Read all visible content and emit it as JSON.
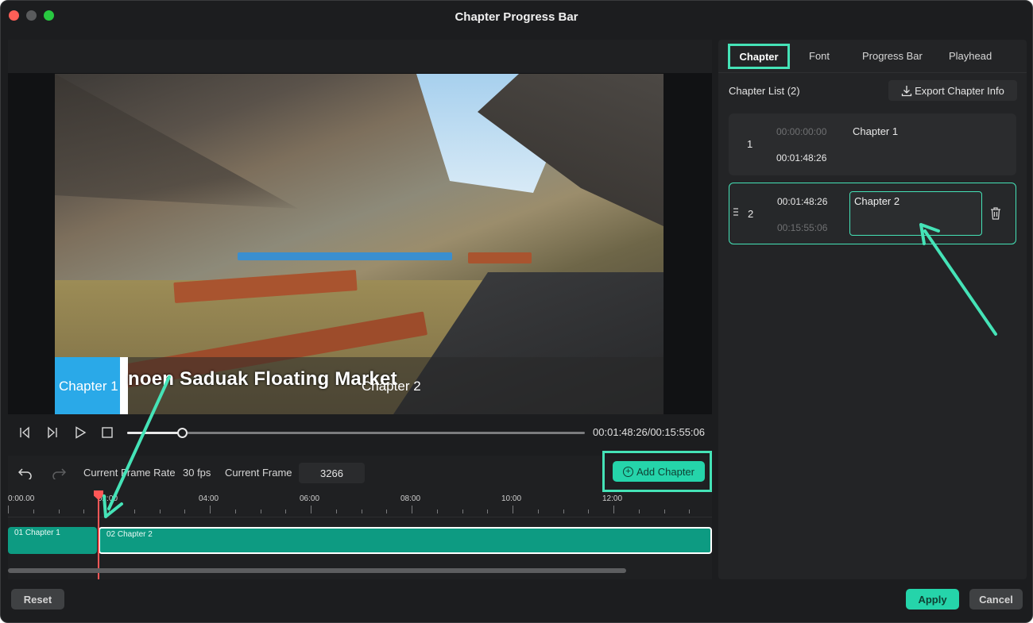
{
  "window": {
    "title": "Chapter Progress Bar"
  },
  "preview": {
    "overlay_text": "noen Saduak Floating Market",
    "caption_chapter1": "Chapter 1",
    "caption_chapter2": "Chapter 2",
    "timecode": "00:01:48:26/00:15:55:06",
    "progress_fraction": 0.12
  },
  "timeline": {
    "frame_rate_label": "Current Frame Rate",
    "frame_rate_value": "30 fps",
    "current_frame_label": "Current Frame",
    "current_frame_value": "3266",
    "add_chapter_label": "Add Chapter",
    "ruler_labels": [
      "0:00.00",
      "02:00",
      "04:00",
      "06:00",
      "08:00",
      "10:00",
      "12:00"
    ],
    "clips": [
      {
        "label": "01 Chapter 1"
      },
      {
        "label": "02 Chapter 2"
      }
    ]
  },
  "panel": {
    "tabs": [
      "Chapter",
      "Font",
      "Progress Bar",
      "Playhead"
    ],
    "active_tab": "Chapter",
    "chapter_list_title": "Chapter List (2)",
    "export_label": "Export Chapter Info",
    "chapters": [
      {
        "index": "1",
        "start": "00:00:00:00",
        "end": "00:01:48:26",
        "name": "Chapter 1"
      },
      {
        "index": "2",
        "start": "00:01:48:26",
        "end": "00:15:55:06",
        "name": "Chapter 2"
      }
    ]
  },
  "footer": {
    "reset_label": "Reset",
    "apply_label": "Apply",
    "cancel_label": "Cancel"
  },
  "colors": {
    "accent": "#25d4aa",
    "highlight": "#45e3b7",
    "clip": "#0d9b82",
    "playhead": "#ff5757",
    "caption_blue": "#2aa9e8"
  }
}
